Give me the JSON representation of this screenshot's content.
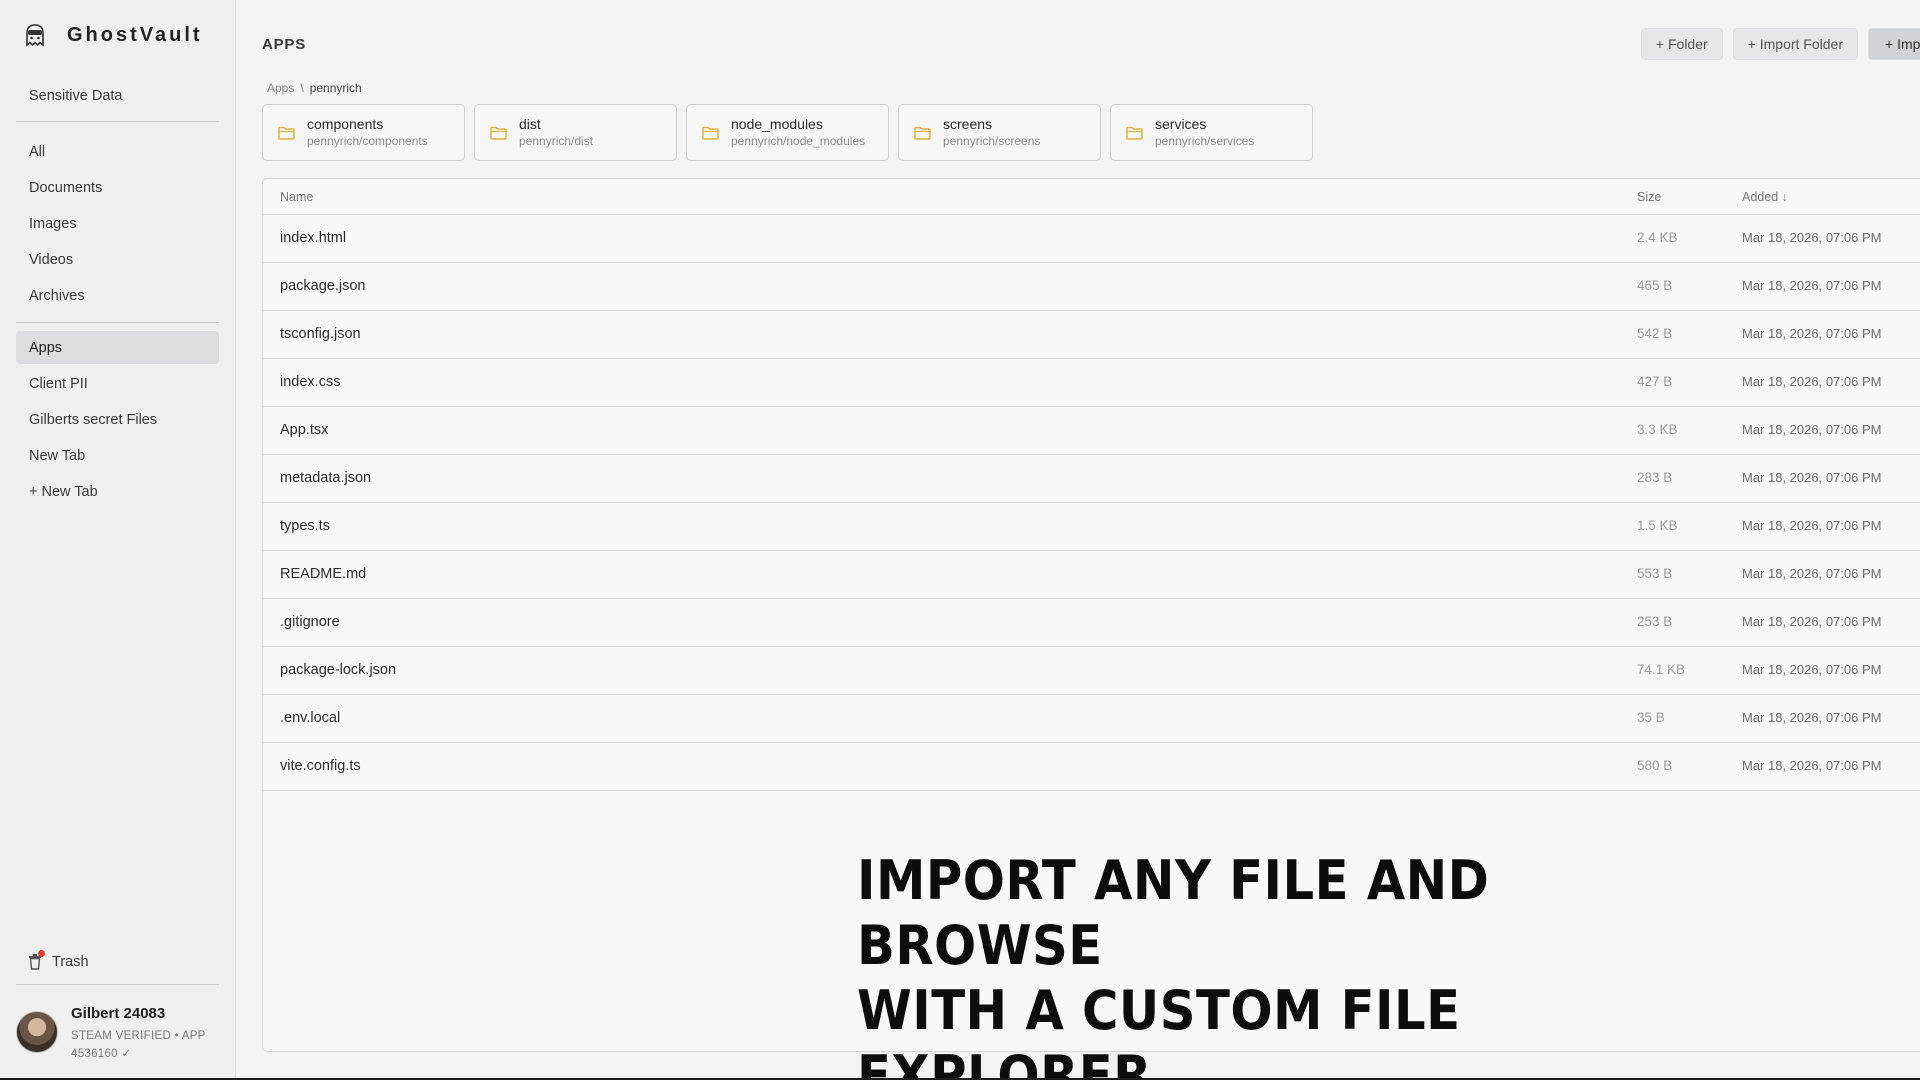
{
  "app": {
    "name": "GhostVault"
  },
  "sidebar": {
    "section_title": "Sensitive Data",
    "filters": [
      {
        "label": "All"
      },
      {
        "label": "Documents"
      },
      {
        "label": "Images"
      },
      {
        "label": "Videos"
      },
      {
        "label": "Archives"
      }
    ],
    "tabs": [
      {
        "label": "Apps",
        "active": true
      },
      {
        "label": "Client PII"
      },
      {
        "label": "Gilberts secret Files"
      },
      {
        "label": "New Tab"
      }
    ],
    "add_tab_label": "+ New Tab",
    "trash_label": "Trash",
    "user": {
      "name": "Gilbert 24083",
      "meta": "STEAM VERIFIED • APP 4536160 ✓"
    }
  },
  "header": {
    "title": "APPS",
    "actions": [
      "+ Folder",
      "+ Import Folder",
      "+ Imp"
    ]
  },
  "breadcrumb": {
    "root": "Apps",
    "separator": "\\",
    "current": "pennyrich"
  },
  "folders": [
    {
      "name": "components",
      "path": "pennyrich/components"
    },
    {
      "name": "dist",
      "path": "pennyrich/dist"
    },
    {
      "name": "node_modules",
      "path": "pennyrich/node_modules"
    },
    {
      "name": "screens",
      "path": "pennyrich/screens"
    },
    {
      "name": "services",
      "path": "pennyrich/services"
    }
  ],
  "table": {
    "columns": {
      "name": "Name",
      "size": "Size",
      "added": "Added ↓"
    },
    "rows": [
      {
        "name": "index.html",
        "size": "2.4 KB",
        "added": "Mar 18, 2026, 07:06 PM"
      },
      {
        "name": "package.json",
        "size": "465 B",
        "added": "Mar 18, 2026, 07:06 PM"
      },
      {
        "name": "tsconfig.json",
        "size": "542 B",
        "added": "Mar 18, 2026, 07:06 PM"
      },
      {
        "name": "index.css",
        "size": "427 B",
        "added": "Mar 18, 2026, 07:06 PM"
      },
      {
        "name": "App.tsx",
        "size": "3.3 KB",
        "added": "Mar 18, 2026, 07:06 PM"
      },
      {
        "name": "metadata.json",
        "size": "283 B",
        "added": "Mar 18, 2026, 07:06 PM"
      },
      {
        "name": "types.ts",
        "size": "1.5 KB",
        "added": "Mar 18, 2026, 07:06 PM"
      },
      {
        "name": "README.md",
        "size": "553 B",
        "added": "Mar 18, 2026, 07:06 PM"
      },
      {
        "name": ".gitignore",
        "size": "253 B",
        "added": "Mar 18, 2026, 07:06 PM"
      },
      {
        "name": "package-lock.json",
        "size": "74.1 KB",
        "added": "Mar 18, 2026, 07:06 PM"
      },
      {
        "name": ".env.local",
        "size": "35 B",
        "added": "Mar 18, 2026, 07:06 PM"
      },
      {
        "name": "vite.config.ts",
        "size": "580 B",
        "added": "Mar 18, 2026, 07:06 PM"
      }
    ]
  },
  "promo": {
    "line1": "IMPORT ANY FILE AND BROWSE",
    "line2": "WITH A CUSTOM FILE EXPLORER"
  },
  "colors": {
    "accent_folder": "#e0b23a",
    "active_nav_bg": "#dcdcdf",
    "notification_dot": "#e53935"
  }
}
